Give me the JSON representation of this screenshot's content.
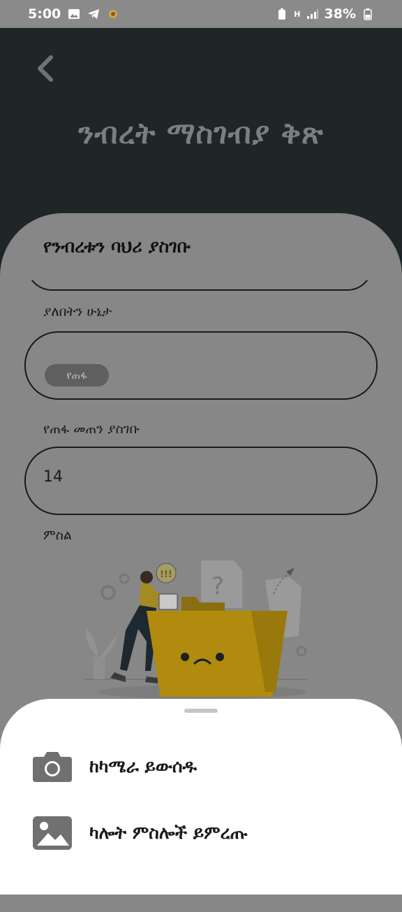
{
  "status_bar": {
    "time": "5:00",
    "battery": "38%",
    "network": "H"
  },
  "header": {
    "title": "ንብረት ማስገብያ ቅጽ"
  },
  "form": {
    "section_title": "የንብረቱን ባህሪ ያስገቡ",
    "status_label": "ያለበትን ሁኔታ",
    "status_chip": "የጠፋ",
    "amount_label": "የጠፋ መጠን ያስገቡ",
    "amount_value": "14",
    "image_label": "ምስል"
  },
  "sheet": {
    "options": [
      {
        "label": "ከካሜራ ይውሰዱ",
        "icon": "camera-icon"
      },
      {
        "label": "ካሎት ምስሎች ይምረጡ",
        "icon": "gallery-icon"
      }
    ]
  },
  "colors": {
    "header_bg": "#1f2628",
    "card_overlay": "#878787",
    "sheet_bg": "#ffffff",
    "folder": "#b38b0a",
    "icon_gray": "#707070"
  }
}
